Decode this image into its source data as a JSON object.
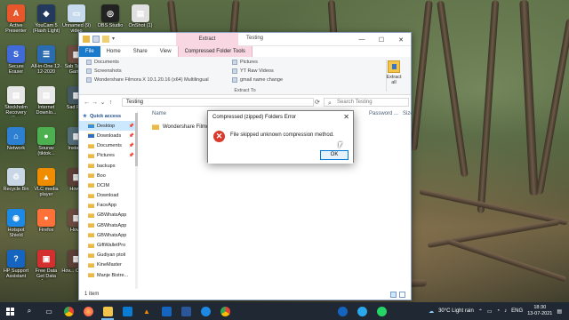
{
  "desktop": {
    "col1": [
      {
        "label": "Active Presenter",
        "color": "#e8562b",
        "glyph": "A"
      },
      {
        "label": "Secure Eraser",
        "color": "#3f6ad8",
        "glyph": "S"
      },
      {
        "label": "Stockholm Recovery Key",
        "color": "#e6e6e6",
        "glyph": "▤"
      },
      {
        "label": "Network",
        "color": "#2d7fd2",
        "glyph": "⌂"
      },
      {
        "label": "Recycle Bin",
        "color": "#c9d6e6",
        "glyph": "♲"
      },
      {
        "label": "Hotspot Shield",
        "color": "#1e88e5",
        "glyph": "◉"
      },
      {
        "label": "HP Support Assistant",
        "color": "#1565c0",
        "glyph": "?"
      }
    ],
    "col2": [
      {
        "label": "YouCam 5 (Flash Light)",
        "color": "#233a5e",
        "glyph": "◆"
      },
      {
        "label": "All-in-One 12-12-2020",
        "color": "#2b6cb0",
        "glyph": "☰"
      },
      {
        "label": "Internet Downlo...",
        "color": "#e8e8e8",
        "glyph": "▤"
      },
      {
        "label": "Sourav (tiktok...",
        "color": "#4caf50",
        "glyph": "●"
      },
      {
        "label": "VLC media player",
        "color": "#f08c00",
        "glyph": "▲"
      },
      {
        "label": "Firefox",
        "color": "#ff7139",
        "glyph": "●"
      },
      {
        "label": "Free Data Get Data Lo...",
        "color": "#d32f2f",
        "glyph": "▣"
      }
    ],
    "col3": [
      {
        "label": "Unnamed (9) video",
        "color": "#c7d9ec",
        "glyph": "▭"
      },
      {
        "label": "Sab Tastes Gam...",
        "color": "#6d4c41",
        "glyph": "▦"
      },
      {
        "label": "Sad Ph...",
        "color": "#455a64",
        "glyph": "▦"
      },
      {
        "label": "Installer",
        "color": "#546e7a",
        "glyph": "▦"
      },
      {
        "label": "How...",
        "color": "#5d4037",
        "glyph": "▦"
      },
      {
        "label": "Hov...",
        "color": "#6d4c41",
        "glyph": "▦"
      },
      {
        "label": "Hov... Chan...",
        "color": "#5d4037",
        "glyph": "▦"
      }
    ],
    "col4": [
      {
        "label": "OBS Studio",
        "color": "#222",
        "glyph": "◎"
      },
      {
        "label": "",
        "color": "transparent",
        "glyph": ""
      }
    ],
    "col5": [
      {
        "label": "OnShot (1)",
        "color": "#e0e0e0",
        "glyph": "▤"
      }
    ]
  },
  "explorer": {
    "context_tab_head": "Extract",
    "window_title": "Testing",
    "controls": {
      "minimize": "—",
      "maximize": "☐",
      "close": "✕"
    },
    "tabs": [
      "File",
      "Home",
      "Share",
      "View",
      "Compressed Folder Tools"
    ],
    "ribbon": {
      "left_items": [
        "Documents",
        "Screenshots",
        "Wondershare Filmora X 10.1.20.16 (x64) Multilingual"
      ],
      "right_items": [
        "Pictures",
        "YT Raw Videos",
        "gmail name change"
      ],
      "extract_all": "Extract all",
      "group_label": "Extract To"
    },
    "address": {
      "back": "←",
      "forward": "→",
      "recent": "⌄",
      "up": "↑",
      "path": "Testing",
      "search_placeholder": "Search Testing"
    },
    "nav": {
      "quick_access": "Quick access",
      "items": [
        "Desktop",
        "Downloads",
        "Documents",
        "Pictures",
        "backups",
        "Boo",
        "DCIM",
        "Download",
        "FaceApp",
        "GBWhatsApp",
        "GBWhatsApp",
        "GBWhatsApp",
        "GiftWalletPro",
        "Gudiyan ptoli",
        "KineMaster",
        "Manje Bistre..."
      ]
    },
    "columns": {
      "name": "Name",
      "password": "Password ...",
      "size": "Size"
    },
    "files": [
      {
        "name": "Wondershare Filmora"
      }
    ],
    "status": "1 item"
  },
  "dialog": {
    "title": "Compressed (zipped) Folders Error",
    "message": "File skipped unknown compression method.",
    "ok": "OK",
    "close": "✕"
  },
  "taskbar": {
    "weather": "30°C  Light rain",
    "lang": "ENG",
    "time": "18:30",
    "date": "13-07-2021"
  }
}
